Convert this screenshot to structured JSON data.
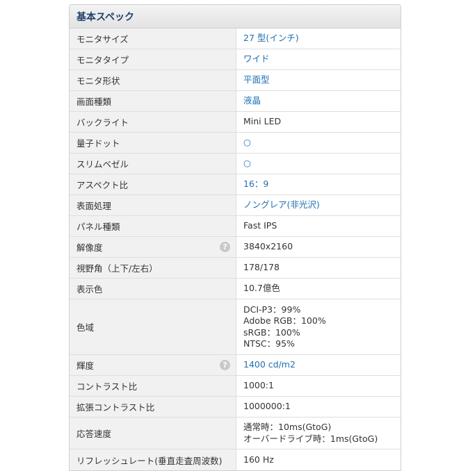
{
  "panel": {
    "title": "基本スペック"
  },
  "help_icon_glyph": "?",
  "rows": [
    {
      "label": "モニタサイズ",
      "value": "27 型(インチ)",
      "link": true
    },
    {
      "label": "モニタタイプ",
      "value": "ワイド",
      "link": true
    },
    {
      "label": "モニタ形状",
      "value": "平面型",
      "link": true
    },
    {
      "label": "画面種類",
      "value": "液晶",
      "link": true
    },
    {
      "label": "バックライト",
      "value": "Mini LED",
      "link": false
    },
    {
      "label": "量子ドット",
      "value": "○",
      "link": true
    },
    {
      "label": "スリムベゼル",
      "value": "○",
      "link": true
    },
    {
      "label": "アスペクト比",
      "value": "16：9",
      "link": true
    },
    {
      "label": "表面処理",
      "value": "ノングレア(非光沢)",
      "link": true
    },
    {
      "label": "パネル種類",
      "value": "Fast IPS",
      "link": false
    },
    {
      "label": "解像度",
      "value": "3840x2160",
      "link": false,
      "help": true
    },
    {
      "label": "視野角（上下/左右）",
      "value": "178/178",
      "link": false
    },
    {
      "label": "表示色",
      "value": "10.7億色",
      "link": false
    },
    {
      "label": "色域",
      "lines": [
        "DCI-P3：99%",
        "Adobe RGB：100%",
        "sRGB：100%",
        "NTSC：95%"
      ],
      "link": false
    },
    {
      "label": "輝度",
      "value": "1400 cd/m2",
      "link": true,
      "help": true
    },
    {
      "label": "コントラスト比",
      "value": "1000:1",
      "link": false
    },
    {
      "label": "拡張コントラスト比",
      "value": "1000000:1",
      "link": false
    },
    {
      "label": "応答速度",
      "lines": [
        "通常時：10ms(GtoG)",
        "オーバードライブ時：1ms(GtoG)"
      ],
      "link": false
    },
    {
      "label": "リフレッシュレート(垂直走査周波数)",
      "value": "160 Hz",
      "link": false
    }
  ]
}
